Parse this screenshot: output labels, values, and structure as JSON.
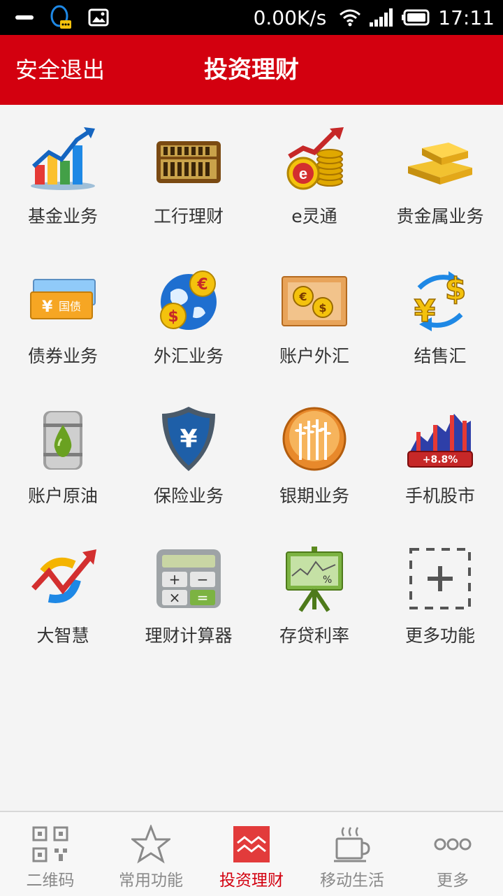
{
  "status_bar": {
    "net_speed": "0.00K/s",
    "time": "17:11"
  },
  "header": {
    "logout_label": "安全退出",
    "title": "投资理财"
  },
  "colors": {
    "brand_red": "#d3000f",
    "tab_inactive": "#8a8a8a"
  },
  "grid": {
    "items": [
      {
        "label": "基金业务",
        "icon": "fund-chart-icon"
      },
      {
        "label": "工行理财",
        "icon": "abacus-icon"
      },
      {
        "label": "e灵通",
        "icon": "e-coins-icon"
      },
      {
        "label": "贵金属业务",
        "icon": "gold-bars-icon"
      },
      {
        "label": "债券业务",
        "icon": "bond-icon"
      },
      {
        "label": "外汇业务",
        "icon": "globe-currency-icon"
      },
      {
        "label": "账户外汇",
        "icon": "account-fx-icon"
      },
      {
        "label": "结售汇",
        "icon": "exchange-icon"
      },
      {
        "label": "账户原油",
        "icon": "oil-barrel-icon"
      },
      {
        "label": "保险业务",
        "icon": "insurance-shield-icon"
      },
      {
        "label": "银期业务",
        "icon": "wheat-icon"
      },
      {
        "label": "手机股市",
        "icon": "stock-chart-icon"
      },
      {
        "label": "大智慧",
        "icon": "dzh-logo-icon"
      },
      {
        "label": "理财计算器",
        "icon": "calculator-icon"
      },
      {
        "label": "存贷利率",
        "icon": "rate-board-icon"
      },
      {
        "label": "更多功能",
        "icon": "add-more-icon"
      }
    ],
    "stock_badge": "+8.8%",
    "bond_badge": "国债",
    "calc_keys": [
      "+",
      "−",
      "×",
      "="
    ]
  },
  "tabbar": {
    "tabs": [
      {
        "label": "二维码",
        "icon": "qrcode-icon"
      },
      {
        "label": "常用功能",
        "icon": "star-icon"
      },
      {
        "label": "投资理财",
        "icon": "invest-icon",
        "active": true
      },
      {
        "label": "移动生活",
        "icon": "coffee-icon"
      },
      {
        "label": "更多",
        "icon": "more-dots-icon"
      }
    ]
  }
}
